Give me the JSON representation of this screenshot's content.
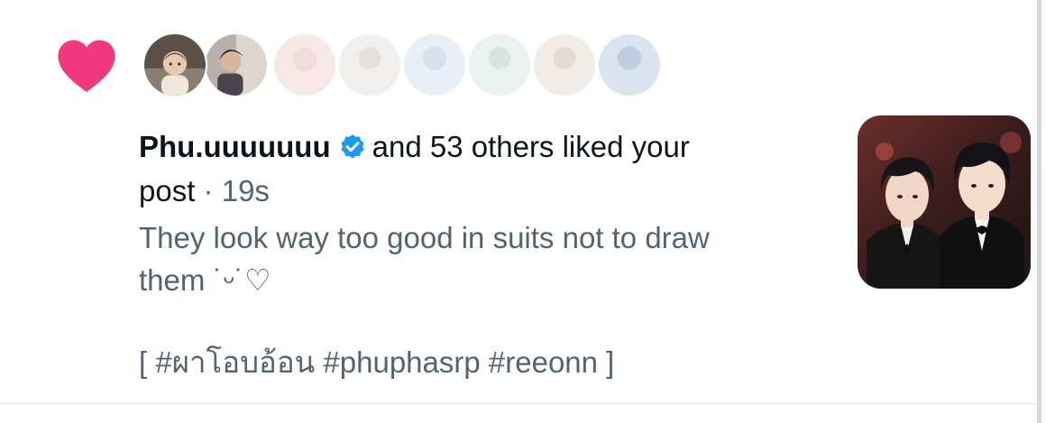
{
  "notification": {
    "type_icon": "heart-icon",
    "accent_color": "#f0397e",
    "avatars": [
      {
        "icon": "avatar-photo-baby"
      },
      {
        "icon": "avatar-photo-portrait"
      },
      {
        "icon": "avatar-blurred-pink"
      },
      {
        "icon": "avatar-blurred-gray"
      },
      {
        "icon": "avatar-blurred-blue"
      },
      {
        "icon": "avatar-blurred-teal"
      },
      {
        "icon": "avatar-blurred-brown"
      },
      {
        "icon": "avatar-blurred-navy"
      }
    ],
    "username": "Phu.uuuuuuu",
    "verified_badge_color": "#1d9bf0",
    "action_text": "and 53 others liked your",
    "action_text_2": "post",
    "separator": "·",
    "timestamp": "19s",
    "snippet_line1": "They look way too good in suits not to draw",
    "snippet_line2": "them ˙ᵕ˙♡",
    "hashtags": "[ #ผาโอบอ้อน #phuphasrp #reeonn ]",
    "thumbnail": "post-thumbnail-illustration"
  }
}
